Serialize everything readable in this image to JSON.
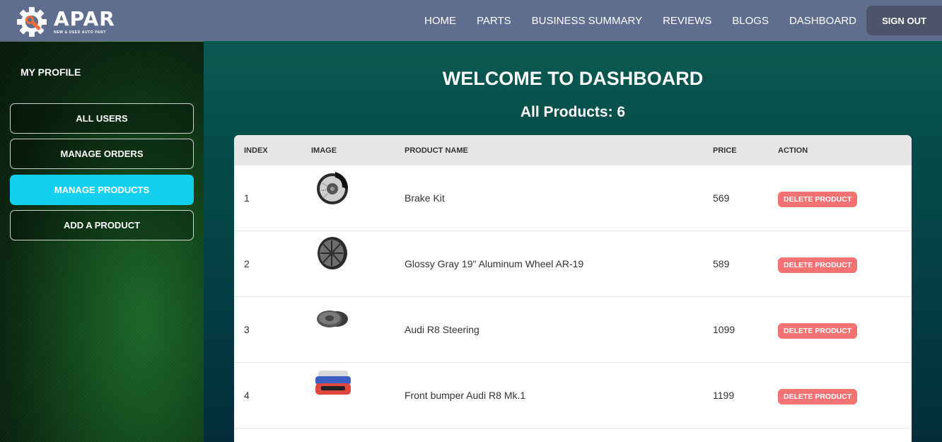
{
  "brand": {
    "name": "APAR",
    "tagline": "NEW & USED AUTO PART"
  },
  "nav": {
    "items": [
      "HOME",
      "PARTS",
      "BUSINESS SUMMARY",
      "REVIEWS",
      "BLOGS",
      "DASHBOARD"
    ],
    "signout": "SIGN OUT"
  },
  "sidebar": {
    "title": "MY PROFILE",
    "items": [
      {
        "label": "ALL USERS",
        "active": false
      },
      {
        "label": "MANAGE ORDERS",
        "active": false
      },
      {
        "label": "MANAGE PRODUCTS",
        "active": true
      },
      {
        "label": "ADD A PRODUCT",
        "active": false
      }
    ]
  },
  "main": {
    "welcome": "WELCOME TO DASHBOARD",
    "count": "All Products: 6",
    "table": {
      "headers": [
        "INDEX",
        "IMAGE",
        "PRODUCT NAME",
        "PRICE",
        "ACTION"
      ],
      "rows": [
        {
          "index": "1",
          "image": "brake-kit-image",
          "name": "Brake Kit",
          "price": "569",
          "action": "DELETE PRODUCT"
        },
        {
          "index": "2",
          "image": "wheel-image",
          "name": "Glossy Gray 19\" Aluminum Wheel AR-19",
          "price": "589",
          "action": "DELETE PRODUCT"
        },
        {
          "index": "3",
          "image": "brake-disc-image",
          "name": "Audi R8 Steering",
          "price": "1099",
          "action": "DELETE PRODUCT"
        },
        {
          "index": "4",
          "image": "bumper-image",
          "name": "Front bumper Audi R8 Mk.1",
          "price": "1199",
          "action": "DELETE PRODUCT"
        }
      ]
    }
  },
  "colors": {
    "topbar": "#5f6e8e",
    "accent": "#14d0ef",
    "delete": "#f47272",
    "brand_orange": "#f26b3a"
  }
}
